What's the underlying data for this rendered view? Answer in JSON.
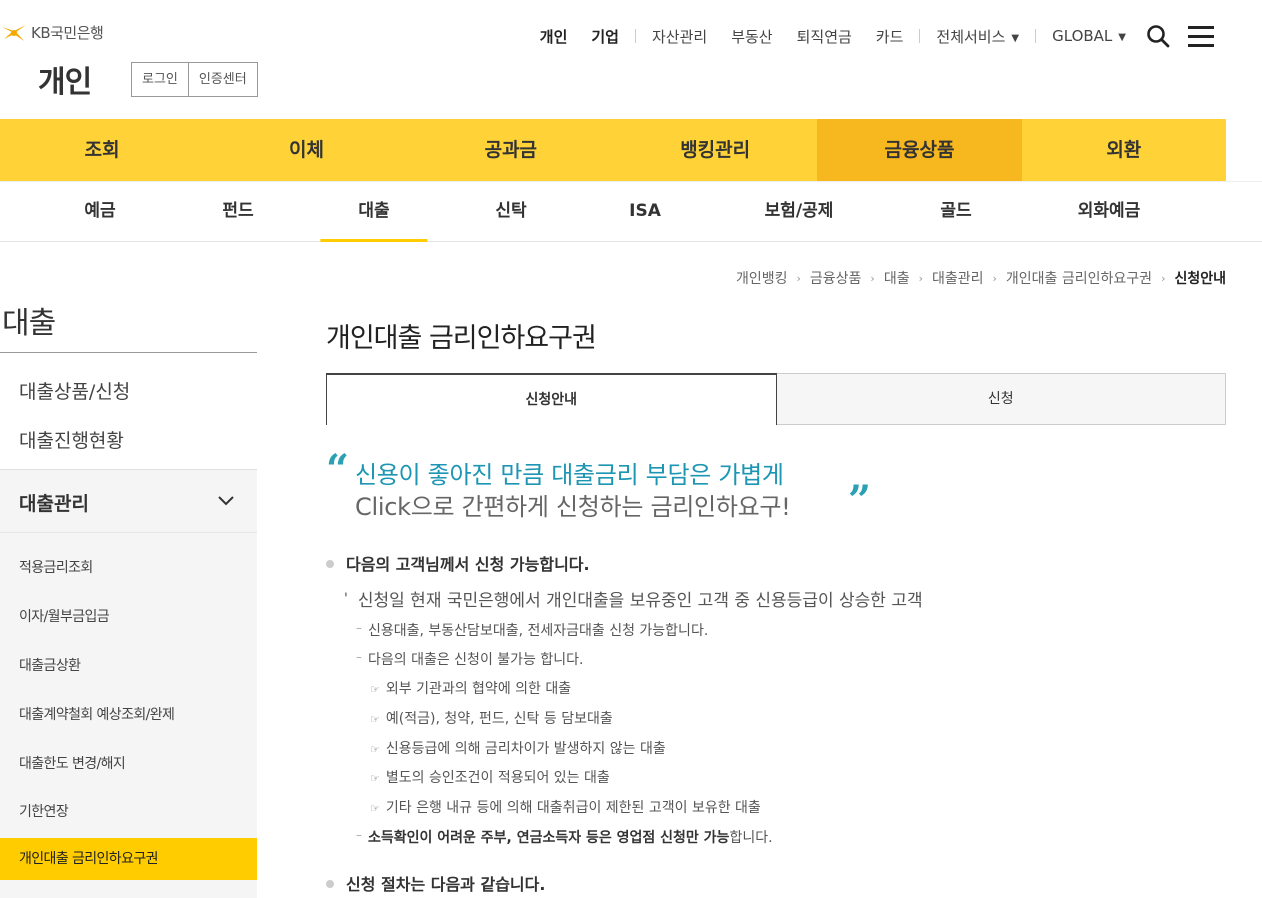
{
  "header": {
    "logo_text": "KB국민은행",
    "section_title": "개인",
    "login_label": "로그인",
    "cert_label": "인증센터"
  },
  "util_nav": {
    "personal": "개인",
    "corporate": "기업",
    "asset": "자산관리",
    "realestate": "부동산",
    "pension": "퇴직연금",
    "card": "카드",
    "allservice": "전체서비스",
    "global": "GLOBAL"
  },
  "gnb": [
    "조회",
    "이체",
    "공과금",
    "뱅킹관리",
    "금융상품",
    "외환"
  ],
  "sub_gnb": [
    "예금",
    "펀드",
    "대출",
    "신탁",
    "ISA",
    "보험/공제",
    "골드",
    "외화예금"
  ],
  "lnb": {
    "title": "대출",
    "items": [
      "대출상품/신청",
      "대출진행현황"
    ],
    "group_label": "대출관리",
    "sub_items": [
      "적용금리조회",
      "이자/월부금입금",
      "대출금상환",
      "대출계약철회 예상조회/완제",
      "대출한도 변경/해지",
      "기한연장",
      "개인대출 금리인하요구권"
    ]
  },
  "breadcrumb": [
    "개인뱅킹",
    "금융상품",
    "대출",
    "대출관리",
    "개인대출 금리인하요구권",
    "신청안내"
  ],
  "content": {
    "title": "개인대출 금리인하요구권",
    "tabs": [
      "신청안내",
      "신청"
    ],
    "quote_line1": "신용이 좋아진 만큼 대출금리 부담은 가볍게",
    "quote_line2": "Click으로 간편하게 신청하는 금리인하요구!",
    "heading1": "다음의 고객님께서 신청 가능합니다.",
    "line1": "신청일 현재 국민은행에서 개인대출을 보유중인 고객 중 신용등급이 상승한 고객",
    "dash1": "신용대출, 부동산담보대출, 전세자금대출 신청 가능합니다.",
    "dash2": "다음의 대출은 신청이 불가능 합니다.",
    "excluded": [
      "외부 기관과의 협약에 의한 대출",
      "예(적금), 청약, 펀드, 신탁 등 담보대출",
      "신용등급에 의해 금리차이가 발생하지 않는 대출",
      "별도의 승인조건이 적용되어 있는 대출",
      "기타 은행 내규 등에 의해 대출취급이 제한된 고객이 보유한 대출"
    ],
    "dash3_bold": "소득확인이 어려운 주부, 연금소득자 등은 영업점 신청만 가능",
    "dash3_rest": "합니다.",
    "heading2": "신청 절차는 다음과 같습니다."
  },
  "colors": {
    "gnb_bg": "#ffd338",
    "gnb_active": "#f7b81f",
    "highlight": "#ffcc00",
    "quote_blue": "#1d96b3"
  }
}
